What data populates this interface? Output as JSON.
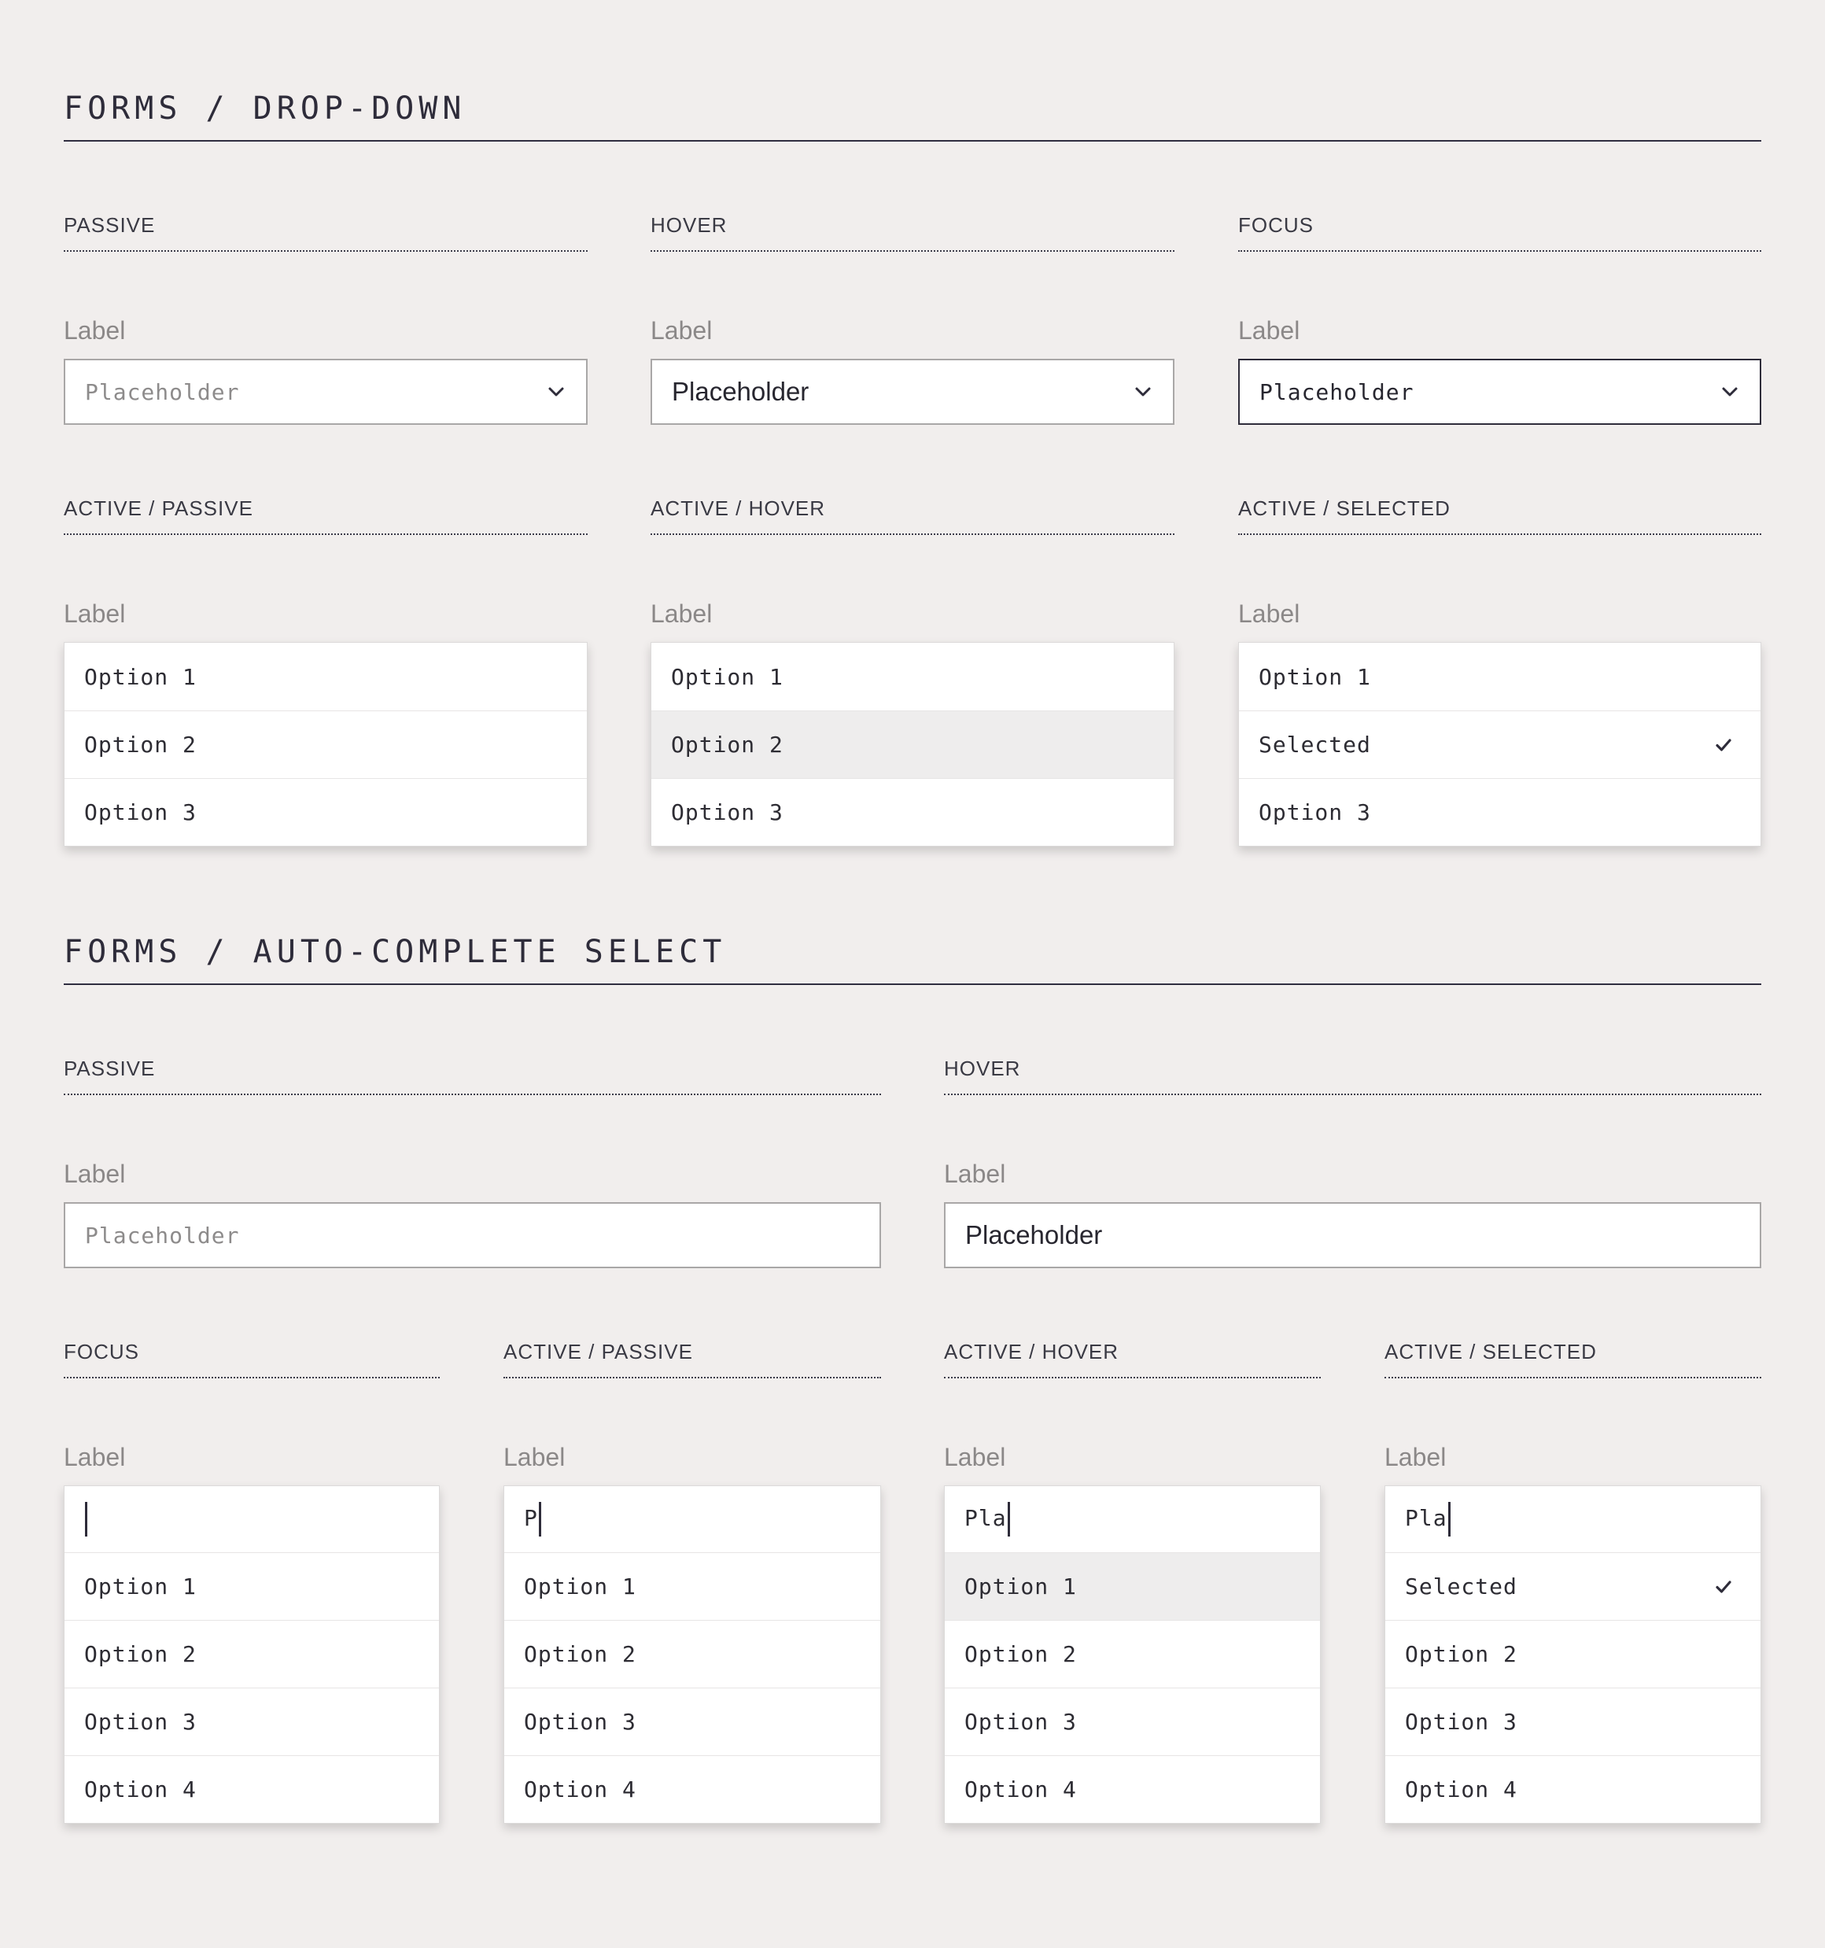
{
  "colors": {
    "background": "#f1eeed",
    "heading": "#2e2c3a",
    "label": "#8b8888",
    "border": "#a9a7a7",
    "focus_border": "#2e2c3a",
    "highlight_row": "#eeeded"
  },
  "dropdown": {
    "title": "FORMS / DROP-DOWN",
    "passive": {
      "heading": "PASSIVE",
      "label": "Label",
      "placeholder": "Placeholder",
      "icon": "chevron-down-icon"
    },
    "hover": {
      "heading": "HOVER",
      "label": "Label",
      "placeholder": "Placeholder",
      "icon": "chevron-down-icon"
    },
    "focus": {
      "heading": "FOCUS",
      "label": "Label",
      "placeholder": "Placeholder",
      "icon": "chevron-down-icon"
    },
    "active_passive": {
      "heading": "ACTIVE / PASSIVE",
      "label": "Label",
      "options": [
        "Option 1",
        "Option 2",
        "Option 3"
      ]
    },
    "active_hover": {
      "heading": "ACTIVE / HOVER",
      "label": "Label",
      "options": [
        "Option 1",
        "Option 2",
        "Option 3"
      ],
      "highlighted_option": "Option 2"
    },
    "active_selected": {
      "heading": "ACTIVE / SELECTED",
      "label": "Label",
      "options": [
        "Option 1",
        "Selected",
        "Option 3"
      ],
      "selected_option": "Selected",
      "selected_icon": "check-icon"
    }
  },
  "autocomplete": {
    "title": "FORMS / AUTO-COMPLETE SELECT",
    "passive": {
      "heading": "PASSIVE",
      "label": "Label",
      "placeholder": "Placeholder"
    },
    "hover": {
      "heading": "HOVER",
      "label": "Label",
      "placeholder": "Placeholder"
    },
    "focus": {
      "heading": "FOCUS",
      "label": "Label",
      "input_value": "",
      "options": [
        "Option 1",
        "Option 2",
        "Option 3",
        "Option 4"
      ]
    },
    "active_passive": {
      "heading": "ACTIVE / PASSIVE",
      "label": "Label",
      "input_value": "P",
      "options": [
        "Option 1",
        "Option 2",
        "Option 3",
        "Option 4"
      ]
    },
    "active_hover": {
      "heading": "ACTIVE / HOVER",
      "label": "Label",
      "input_value": "Pla",
      "options": [
        "Option 1",
        "Option 2",
        "Option 3",
        "Option 4"
      ],
      "highlighted_option": "Option 1"
    },
    "active_selected": {
      "heading": "ACTIVE / SELECTED",
      "label": "Label",
      "input_value": "Pla",
      "options": [
        "Selected",
        "Option 2",
        "Option 3",
        "Option 4"
      ],
      "selected_option": "Selected",
      "selected_icon": "check-icon"
    }
  }
}
